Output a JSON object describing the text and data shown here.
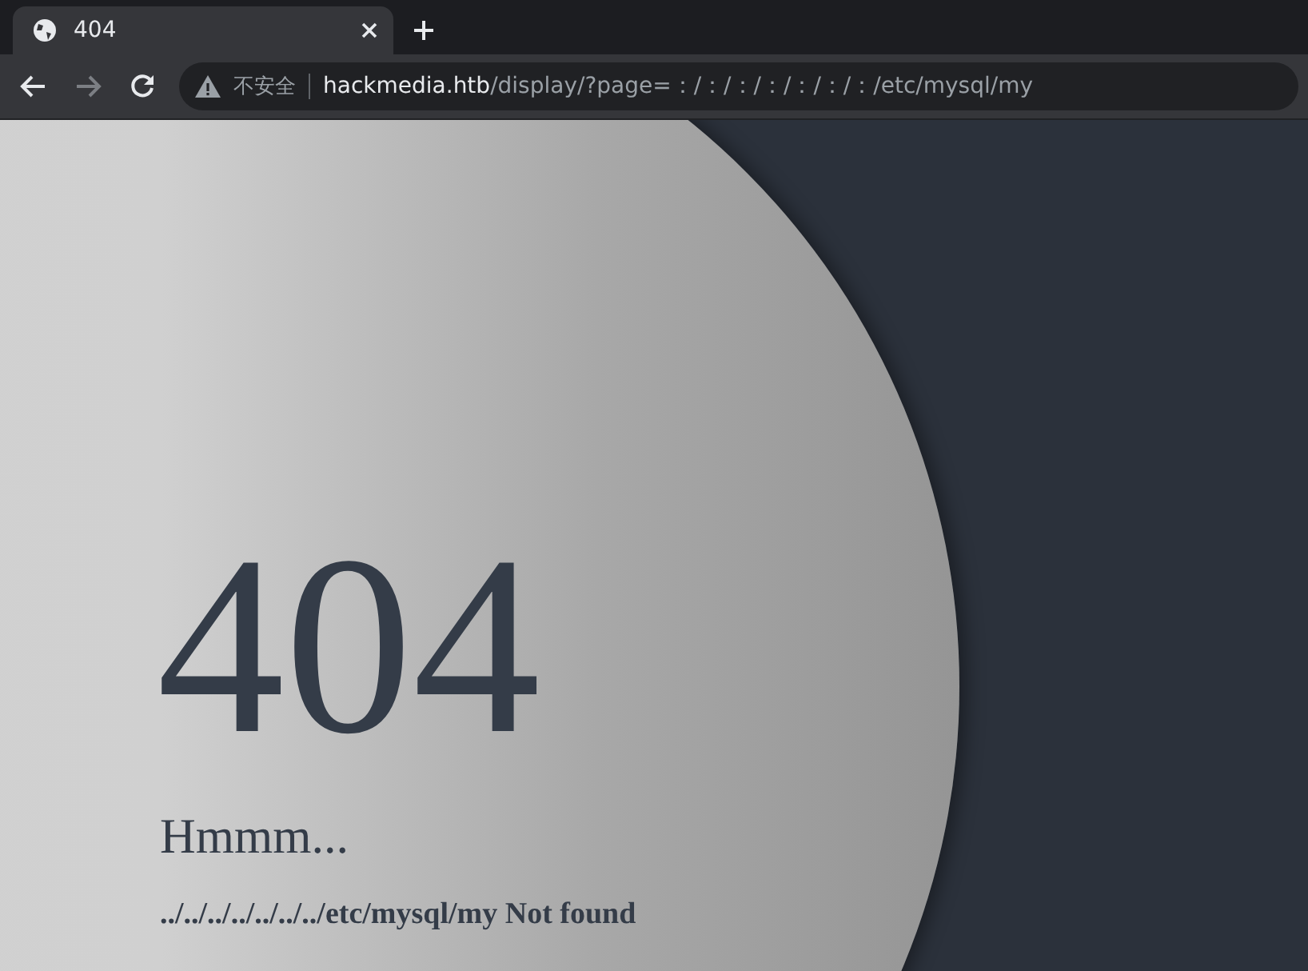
{
  "tab": {
    "title": "404"
  },
  "address_bar": {
    "security": "不安全",
    "host": "hackmedia.htb",
    "path": "/display/?page=：/：/：/：/：/：/：/etc/mysql/my"
  },
  "page": {
    "code": "404",
    "heading": "Hmmm...",
    "message": "../../../../../../../etc/mysql/my Not found"
  }
}
